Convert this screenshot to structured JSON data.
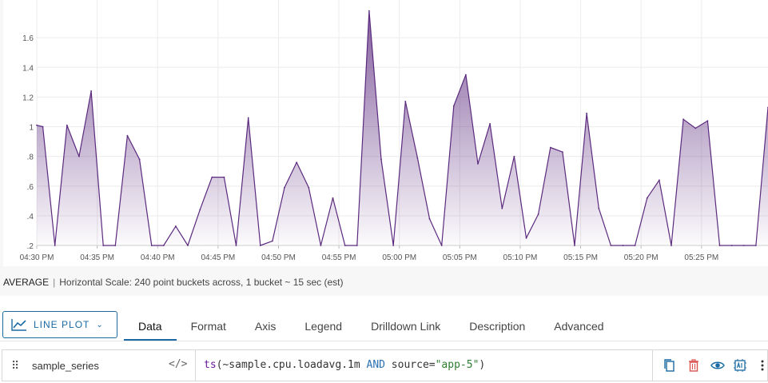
{
  "chart_data": {
    "type": "area",
    "title": "",
    "xlabel": "",
    "ylabel": "",
    "ylim": [
      0.2,
      1.8
    ],
    "yticks": [
      ".2",
      ".4",
      ".6",
      ".8",
      "1",
      "1.2",
      "1.4",
      "1.6"
    ],
    "ytick_values": [
      0.2,
      0.4,
      0.6,
      0.8,
      1.0,
      1.2,
      1.4,
      1.6
    ],
    "xticks": [
      "04:30 PM",
      "04:35 PM",
      "04:40 PM",
      "04:45 PM",
      "04:50 PM",
      "04:55 PM",
      "05:00 PM",
      "05:05 PM",
      "05:10 PM",
      "05:15 PM",
      "05:20 PM",
      "05:25 PM"
    ],
    "xtick_minutes": [
      0,
      5,
      10,
      15,
      20,
      25,
      30,
      35,
      40,
      45,
      50,
      55
    ],
    "xlim_minutes": [
      0,
      60.5
    ],
    "grid": true,
    "series": [
      {
        "color": "#5b2a7e",
        "x_minutes": [
          0,
          0.5,
          1.5,
          2.5,
          3.5,
          4.5,
          5.5,
          6.5,
          7.5,
          8.5,
          9.5,
          10.5,
          11.5,
          12.5,
          13.5,
          14.5,
          15.5,
          16.5,
          17.5,
          18.5,
          19.5,
          20.5,
          21.5,
          22.5,
          23.5,
          24.5,
          25.5,
          26.5,
          27.5,
          28.5,
          29.5,
          30.5,
          31.5,
          32.5,
          33.5,
          34.5,
          35.5,
          36.5,
          37.5,
          38.5,
          39.5,
          40.5,
          41.5,
          42.5,
          43.5,
          44.5,
          45.5,
          46.5,
          47.5,
          48.5,
          49.5,
          50.5,
          51.5,
          52.5,
          53.5,
          54.5,
          55.5,
          56.5,
          57.5,
          58.5,
          59.5,
          60.5
        ],
        "values": [
          1.01,
          1.0,
          0.2,
          1.01,
          0.8,
          1.24,
          0.2,
          0.2,
          0.94,
          0.78,
          0.2,
          0.2,
          0.33,
          0.2,
          0.44,
          0.66,
          0.66,
          0.2,
          1.06,
          0.2,
          0.23,
          0.59,
          0.76,
          0.59,
          0.2,
          0.52,
          0.2,
          0.2,
          1.78,
          0.78,
          0.2,
          1.17,
          0.79,
          0.38,
          0.2,
          1.14,
          1.35,
          0.75,
          1.02,
          0.45,
          0.8,
          0.25,
          0.41,
          0.86,
          0.83,
          0.2,
          1.09,
          0.45,
          0.2,
          0.2,
          0.2,
          0.52,
          0.64,
          0.2,
          1.05,
          0.99,
          1.04,
          0.2,
          0.2,
          0.2,
          0.2,
          1.13
        ]
      }
    ]
  },
  "summary": {
    "aggregation": "AVERAGE",
    "separator": "|",
    "scale_text": "Horizontal Scale: 240 point buckets across, 1 bucket ~ 15 sec (est)"
  },
  "toolbar": {
    "chart_type_label": "LINE PLOT",
    "chart_type_caret": "⌄",
    "tabs": [
      "Data",
      "Format",
      "Axis",
      "Legend",
      "Drilldown Link",
      "Description",
      "Advanced"
    ],
    "active_tab": "Data"
  },
  "query": {
    "series_name": "sample_series",
    "code_toggle_glyph": "</>",
    "drag_glyph": "⠿",
    "parts": [
      {
        "text": "ts",
        "kind": "fn"
      },
      {
        "text": "(~sample.cpu.loadavg.1m ",
        "kind": "plain"
      },
      {
        "text": "AND",
        "kind": "kw"
      },
      {
        "text": " source=",
        "kind": "plain"
      },
      {
        "text": "\"app-5\"",
        "kind": "str"
      },
      {
        "text": ")",
        "kind": "plain"
      }
    ],
    "actions": [
      {
        "icon": "copy-icon",
        "color": "#1a6aa3"
      },
      {
        "icon": "trash-icon",
        "color": "#d9534f"
      },
      {
        "icon": "eye-icon",
        "color": "#1a6aa3"
      },
      {
        "icon": "ai-assist-icon",
        "color": "#1a6aa3"
      },
      {
        "icon": "more-vertical-icon",
        "color": "#333333"
      }
    ]
  }
}
